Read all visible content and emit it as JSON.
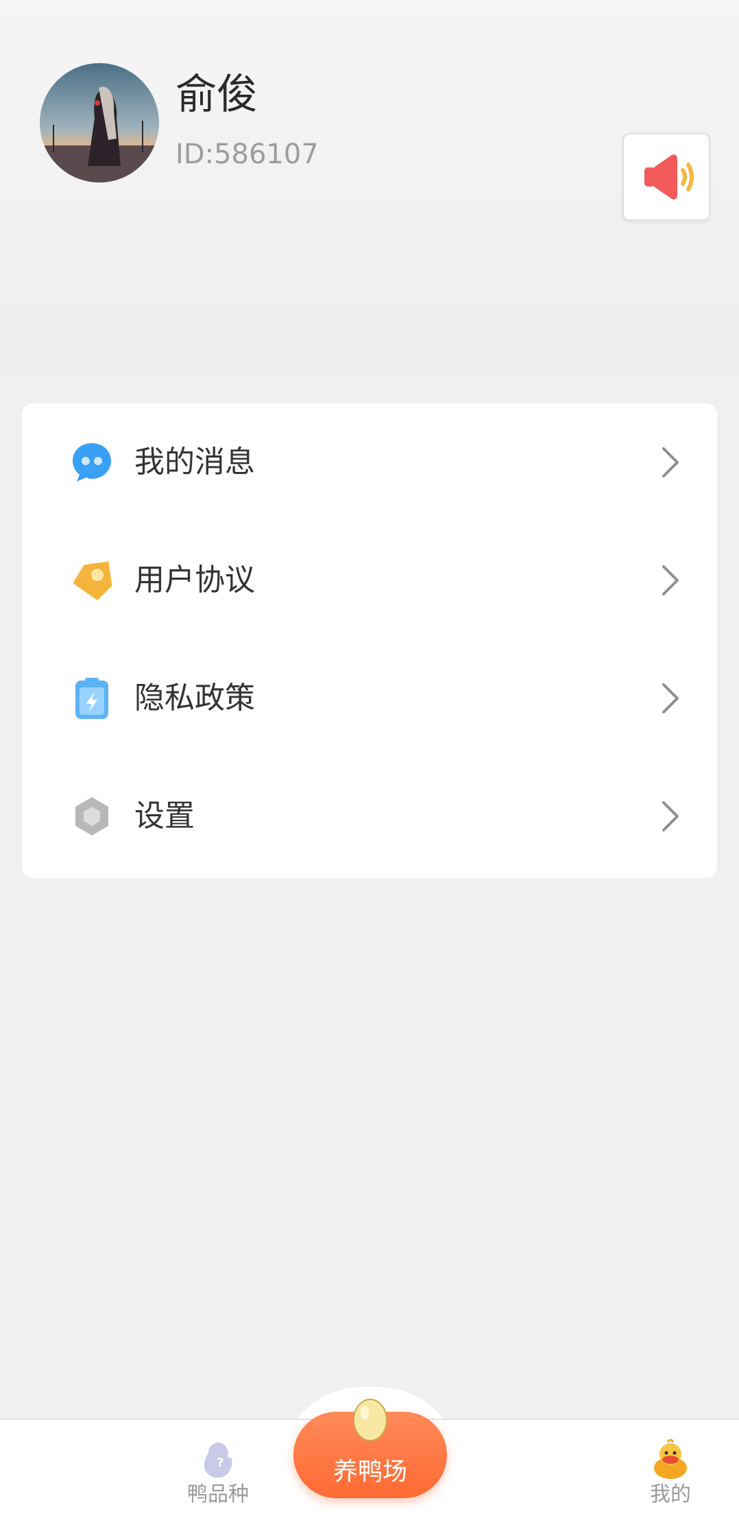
{
  "profile": {
    "name": "俞俊",
    "id_text": "ID:586107"
  },
  "menu": {
    "items": [
      {
        "label": "我的消息",
        "icon": "chat-bubble-icon"
      },
      {
        "label": "用户协议",
        "icon": "tag-icon"
      },
      {
        "label": "隐私政策",
        "icon": "clipboard-icon"
      },
      {
        "label": "设置",
        "icon": "hexagon-settings-icon"
      }
    ]
  },
  "tabbar": {
    "tabs": [
      {
        "label": "鸭品种",
        "icon": "duck-breed-icon",
        "active": false
      },
      {
        "label": "养鸭场",
        "icon": "egg-icon",
        "active": false
      },
      {
        "label": "我的",
        "icon": "duck-icon",
        "active": true
      }
    ]
  },
  "colors": {
    "accent_orange": "#ff6a33",
    "background": "#f0f0f0",
    "card": "#ffffff"
  }
}
